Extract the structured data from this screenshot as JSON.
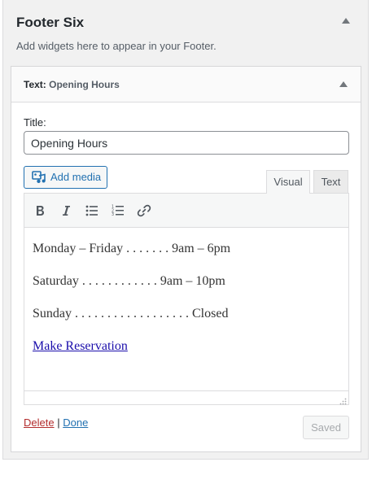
{
  "sidebar": {
    "title": "Footer Six",
    "description": "Add widgets here to appear in your Footer."
  },
  "widget": {
    "type_label": "Text",
    "separator": ":",
    "title_in_widget": "Opening Hours",
    "title_field_label": "Title:",
    "title_field_value": "Opening Hours"
  },
  "editor": {
    "add_media_label": "Add media",
    "tabs": [
      {
        "label": "Visual",
        "active": true
      },
      {
        "label": "Text",
        "active": false
      }
    ],
    "toolbar_icons": [
      "bold-icon",
      "italic-icon",
      "bullet-list-icon",
      "numbered-list-icon",
      "link-icon"
    ],
    "content": {
      "lines": [
        "Monday – Friday . . . . . . . 9am – 6pm",
        "Saturday . . . . . . . . . . . . 9am – 10pm",
        "Sunday . . . . . . . . . . . . . . . . . . Closed"
      ],
      "link_text": "Make Reservation"
    }
  },
  "actions": {
    "delete_label": "Delete",
    "divider": "|",
    "done_label": "Done",
    "saved_label": "Saved"
  },
  "colors": {
    "panel_bg": "#f1f1f1",
    "primary_blue": "#2271b1",
    "delete_red": "#b32d2e",
    "link_color": "#1a0dab"
  }
}
